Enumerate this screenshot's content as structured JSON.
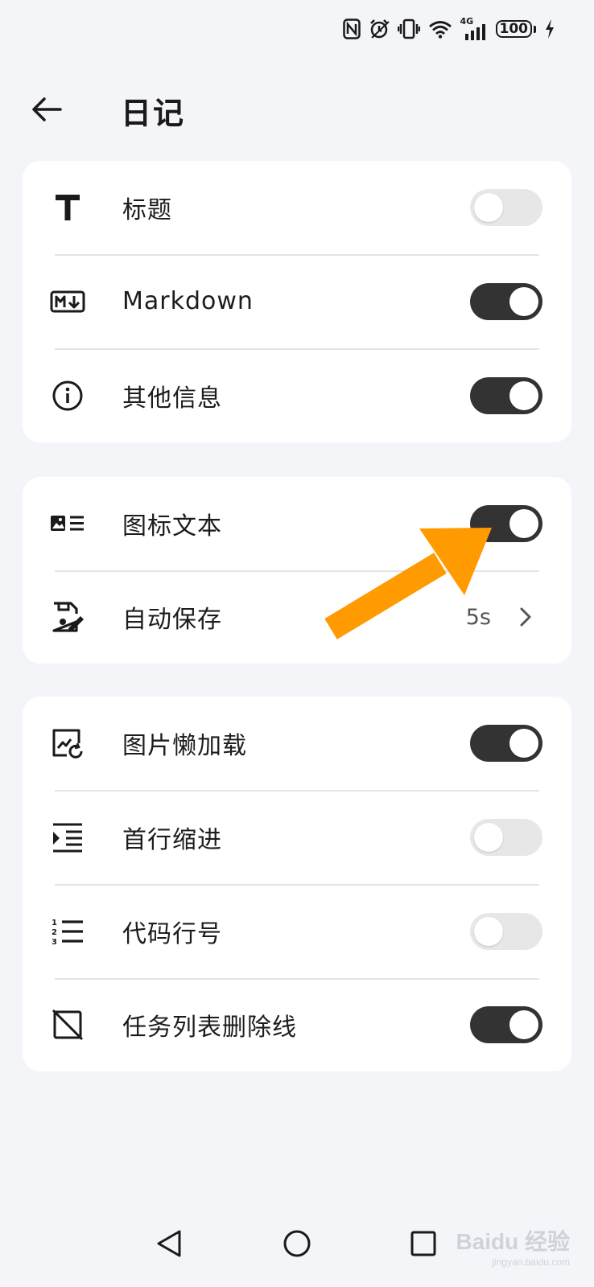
{
  "status_bar": {
    "icons": [
      "nfc-icon",
      "alarm-icon",
      "vibrate-icon",
      "wifi-icon",
      "cellular-4g-icon",
      "battery-icon",
      "charging-icon"
    ],
    "network_label": "4G",
    "battery_level": "100"
  },
  "header": {
    "back_icon": "arrow-left-icon",
    "title": "日记"
  },
  "groups": [
    {
      "items": [
        {
          "icon": "title-icon",
          "label": "标题",
          "toggle": false
        },
        {
          "icon": "markdown-icon",
          "label": "Markdown",
          "toggle": true
        },
        {
          "icon": "info-icon",
          "label": "其他信息",
          "toggle": true
        }
      ]
    },
    {
      "items": [
        {
          "icon": "icon-text-icon",
          "label": "图标文本",
          "toggle": true
        },
        {
          "icon": "autosave-icon",
          "label": "自动保存",
          "value": "5s",
          "chevron": "chevron-right-icon"
        }
      ]
    },
    {
      "items": [
        {
          "icon": "lazy-image-icon",
          "label": "图片懒加载",
          "toggle": true
        },
        {
          "icon": "indent-icon",
          "label": "首行缩进",
          "toggle": false
        },
        {
          "icon": "line-number-icon",
          "label": "代码行号",
          "toggle": false
        },
        {
          "icon": "strikethrough-icon",
          "label": "任务列表删除线",
          "toggle": true
        }
      ]
    }
  ],
  "annotation": {
    "color": "#ff9a00",
    "points_to": "图标文本"
  },
  "nav_bar": {
    "buttons": [
      "back-triangle-icon",
      "home-circle-icon",
      "recents-square-icon"
    ]
  },
  "watermark": {
    "brand": "Baidu 经验",
    "url": "jingyan.baidu.com"
  },
  "colors": {
    "background": "#f4f5f9",
    "card": "#ffffff",
    "toggle_on": "#333333",
    "toggle_off": "#e7e7e7"
  }
}
